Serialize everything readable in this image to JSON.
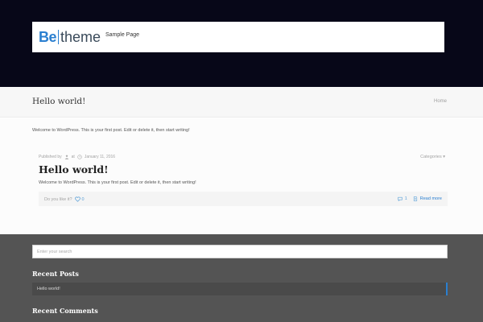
{
  "site": {
    "logo_be": "Be",
    "logo_theme": "theme",
    "nav": [
      {
        "label": "Sample Page"
      }
    ]
  },
  "subheader": {
    "title": "Hello world!",
    "breadcrumb": "Home"
  },
  "content": {
    "intro": "Welcome to WordPress. This is your first post. Edit or delete it, then start writing!",
    "post": {
      "published_by": "Published by",
      "at": "at",
      "date": "January 11, 2016",
      "categories_label": "Categories",
      "title": "Hello world!",
      "excerpt": "Welcome to WordPress. This is your first post. Edit or delete it, then start writing!",
      "like_label": "Do you like it?",
      "like_count": "0",
      "comments_count": "1",
      "read_more": "Read more"
    }
  },
  "footer": {
    "search_placeholder": "Enter your search",
    "recent_posts_title": "Recent Posts",
    "recent_posts": [
      {
        "title": "Hello world!"
      }
    ],
    "recent_comments_title": "Recent Comments"
  },
  "colors": {
    "header_bg": "#070718",
    "accent": "#2a7fd0",
    "footer_bg": "#545454"
  }
}
